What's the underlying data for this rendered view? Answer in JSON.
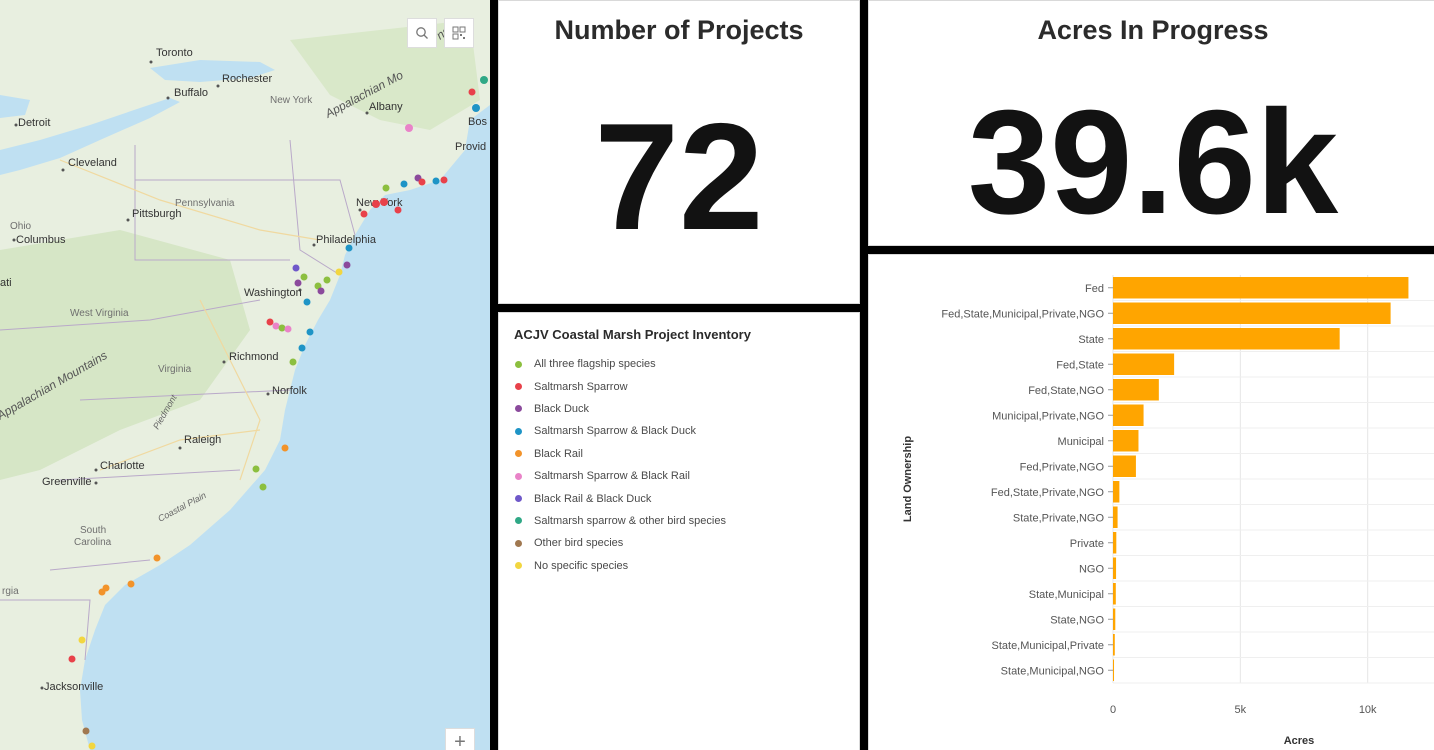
{
  "map": {
    "search_icon": "search-icon",
    "qr_icon": "qr-code-icon",
    "zoom_in_label": "+",
    "cities": [
      "Toronto",
      "Rochester",
      "Buffalo",
      "New York",
      "Albany",
      "Detroit",
      "Bos",
      "Provid",
      "Cleveland",
      "Pennsylvania",
      "Pittsburgh",
      "Ohio",
      "Columbus",
      "New York",
      "Philadelphia",
      "Washington",
      "West Virginia",
      "Richmond",
      "Virginia",
      "Norfolk",
      "Raleigh",
      "Piedmont",
      "Charlotte",
      "Greenville",
      "Coastal Plain",
      "South",
      "Carolina",
      "rgia",
      "Jacksonville",
      "ati"
    ],
    "mountain_labels": [
      "Appalachian Mo",
      "Appalachian Mountains",
      "ns"
    ]
  },
  "kpi_projects": {
    "title": "Number of Projects",
    "value": "72"
  },
  "kpi_acres": {
    "title": "Acres In Progress",
    "value": "39.6k"
  },
  "legend": {
    "title": "ACJV Coastal Marsh Project Inventory",
    "items": [
      {
        "label": "All three flagship species",
        "color": "#8cbf3f"
      },
      {
        "label": "Saltmarsh Sparrow",
        "color": "#e8414a"
      },
      {
        "label": "Black Duck",
        "color": "#8b4a9c"
      },
      {
        "label": "Saltmarsh Sparrow & Black Duck",
        "color": "#1e94c6"
      },
      {
        "label": "Black Rail",
        "color": "#f2932a"
      },
      {
        "label": "Saltmarsh Sparrow & Black Rail",
        "color": "#e983c8"
      },
      {
        "label": "Black Rail & Black Duck",
        "color": "#6f58c9"
      },
      {
        "label": "Saltmarsh sparrow & other bird species",
        "color": "#2fa886"
      },
      {
        "label": "Other bird species",
        "color": "#a07850"
      },
      {
        "label": "No specific species",
        "color": "#f2d640"
      }
    ]
  },
  "chart_data": {
    "type": "bar",
    "orientation": "horizontal",
    "categories": [
      "Fed",
      "Fed,State,Municipal,Private,NGO",
      "State",
      "Fed,State",
      "Fed,State,NGO",
      "Municipal,Private,NGO",
      "Municipal",
      "Fed,Private,NGO",
      "Fed,State,Private,NGO",
      "State,Private,NGO",
      "Private",
      "NGO",
      "State,Municipal",
      "State,NGO",
      "State,Municipal,Private",
      "State,Municipal,NGO"
    ],
    "values": [
      11600,
      10900,
      8900,
      2400,
      1800,
      1200,
      1000,
      900,
      250,
      180,
      130,
      120,
      110,
      90,
      70,
      40
    ],
    "xlabel": "Acres",
    "ylabel": "Land Ownership",
    "xlim": [
      0,
      12800
    ],
    "xticks": [
      0,
      5000,
      10000
    ],
    "xtick_labels": [
      "0",
      "5k",
      "10k"
    ],
    "bar_color": "#ffa500",
    "grid": true
  }
}
